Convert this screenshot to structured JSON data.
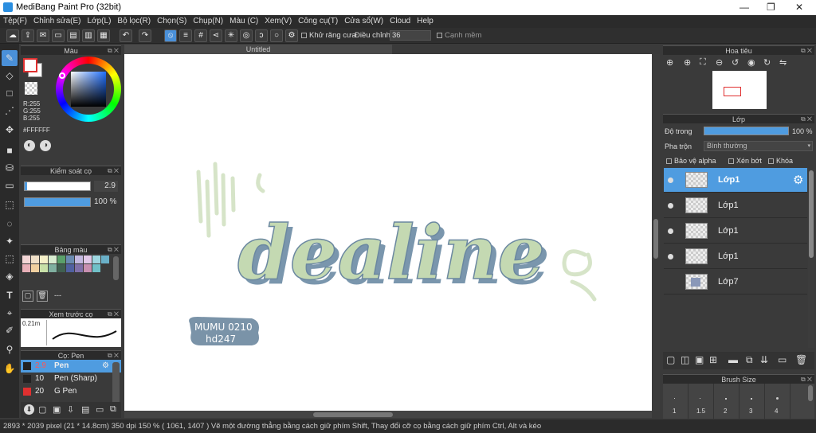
{
  "app": {
    "title": "MediBang Paint Pro (32bit)"
  },
  "menu": [
    "Tệp(F)",
    "Chỉnh sửa(E)",
    "Lớp(L)",
    "Bộ lọc(R)",
    "Chọn(S)",
    "Chụp(N)",
    "Màu (C)",
    "Xem(V)",
    "Công cụ(T)",
    "Cửa sổ(W)",
    "Cloud",
    "Help"
  ],
  "toolbar": {
    "antialias_label": "Khử răng cưa",
    "adjust_label": "Điều chỉnh",
    "adjust_value": "36",
    "edge_label": "Cạnh mềm"
  },
  "color_panel": {
    "title": "Màu",
    "r": "R:255",
    "g": "G:255",
    "b": "B:255",
    "hex": "#FFFFFF"
  },
  "brush_control": {
    "title": "Kiểm soát cọ",
    "size_value": "2.9",
    "opacity_value": "100 %"
  },
  "palette": {
    "title": "Bảng màu",
    "colors": [
      "#f3d6d6",
      "#f0e0c8",
      "#f5f0c8",
      "#d8ecd0",
      "#5aa06a",
      "#6a8ab0",
      "#c3b8e0",
      "#e2c8e8",
      "#9ed6e0",
      "#6ab0c8",
      "#e8b0b8",
      "#f0d0a0",
      "#c8e0a8",
      "#80b0a0",
      "#406050",
      "#5060a0",
      "#8070a8",
      "#c890b0",
      "#70c0c8",
      "#3a3a3a"
    ],
    "extra": "---"
  },
  "brush_preview": {
    "title": "Xem trước cọ",
    "size": "0.21m"
  },
  "brush_list": {
    "title": "Cọ: Pen",
    "items": [
      {
        "size": "2.9",
        "name": "Pen",
        "color": "#222222"
      },
      {
        "size": "10",
        "name": "Pen (Sharp)",
        "color": "#222222"
      },
      {
        "size": "20",
        "name": "G Pen",
        "color": "#e03030"
      }
    ]
  },
  "canvas": {
    "tab": "Untitled",
    "artwork_text": "dealine",
    "signature_line1": "MUMU 0210",
    "signature_line2": "hd247"
  },
  "navigator": {
    "title": "Hoa tiêu"
  },
  "layer_panel": {
    "title": "Lớp",
    "opacity_label": "Độ trong",
    "opacity_value": "100 %",
    "blend_label": "Pha trộn",
    "blend_value": "Bình thường",
    "protect_alpha": "Bảo vệ alpha",
    "clip": "Xén bớt",
    "lock": "Khóa",
    "layers": [
      {
        "name": "Lớp1",
        "selected": true
      },
      {
        "name": "Lớp1",
        "selected": false
      },
      {
        "name": "Lớp1",
        "selected": false
      },
      {
        "name": "Lớp1",
        "selected": false
      },
      {
        "name": "Lớp7",
        "selected": false
      }
    ]
  },
  "brush_size": {
    "title": "Brush Size",
    "values": [
      "1",
      "1.5",
      "2",
      "3",
      "4"
    ]
  },
  "status": {
    "text": "2893 * 2039 pixel   (21 * 14.8cm)   350 dpi   150 %   ( 1061, 1407 )   Vẽ một đường thẳng bằng cách giữ phím Shift, Thay đổi cỡ cọ bằng cách giữ phím Ctrl, Alt và kéo"
  }
}
